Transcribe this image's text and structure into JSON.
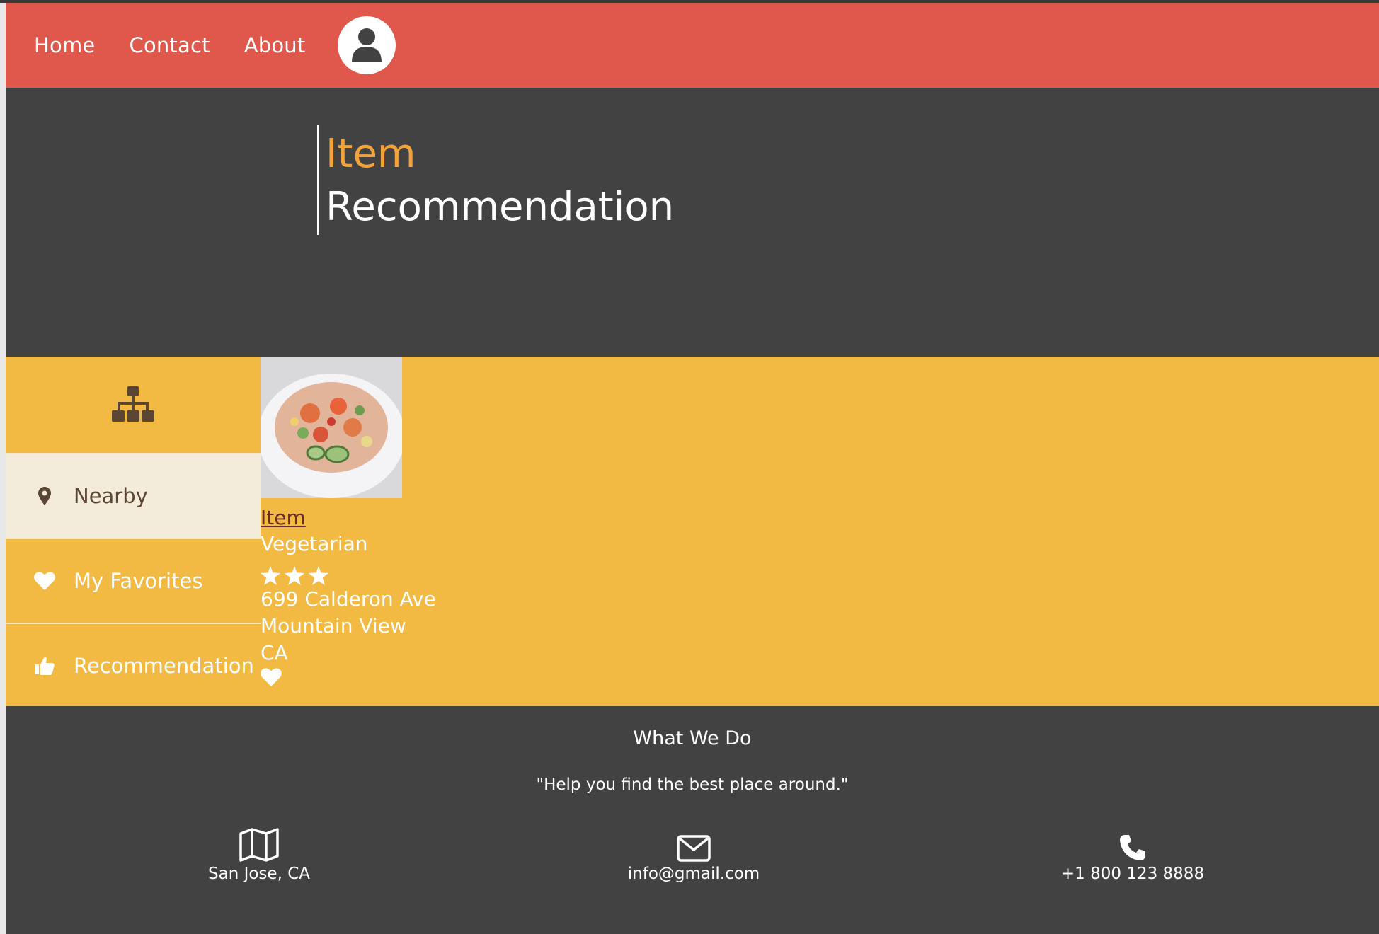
{
  "colors": {
    "header_bg": "#e0574c",
    "dark_bg": "#424242",
    "yellow_bg": "#f2ba42",
    "accent_orange": "#f2a43a",
    "active_item_bg": "#f3ecdb"
  },
  "nav": {
    "links": [
      "Home",
      "Contact",
      "About"
    ],
    "avatar_icon": "user-icon"
  },
  "hero": {
    "line1": "Item",
    "line2": "Recommendation"
  },
  "sidebar": {
    "header_icon": "sitemap-icon",
    "items": [
      {
        "label": "Nearby",
        "icon": "map-pin-icon",
        "active": true
      },
      {
        "label": "My Favorites",
        "icon": "heart-icon",
        "active": false
      },
      {
        "label": "Recommendation",
        "icon": "thumbs-up-icon",
        "active": false
      }
    ]
  },
  "item": {
    "name": "Item",
    "category": "Vegetarian",
    "rating": 3,
    "address_line1": "699 Calderon Ave",
    "address_line2": "Mountain View",
    "address_line3": "CA",
    "favorite_icon": "heart-icon"
  },
  "footer": {
    "title": "What We Do",
    "quote": "\"Help you find the best place around.\"",
    "location": "San Jose, CA",
    "email": "info@gmail.com",
    "phone": "+1 800 123 8888"
  }
}
